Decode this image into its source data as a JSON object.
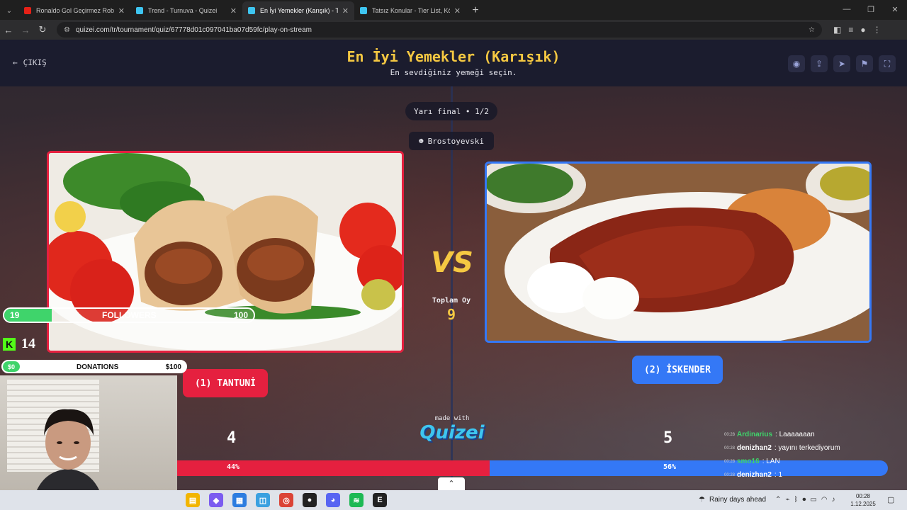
{
  "browser": {
    "tabs": [
      {
        "title": "Ronaldo Gol Geçirmez Robotu",
        "favicon_color": "#e62117",
        "active": false
      },
      {
        "title": "Trend - Turnuva - Quizei",
        "favicon_color": "#3ec5f0",
        "active": false
      },
      {
        "title": "En İyi Yemekler (Karışık) - Tier Li",
        "favicon_color": "#3ec5f0",
        "active": true
      },
      {
        "title": "Tatsız Konular - Tier List, Kör Sı",
        "favicon_color": "#3ec5f0",
        "active": false
      }
    ],
    "url": "quizei.com/tr/tournament/quiz/67778d01c097041ba07d59fc/play-on-stream"
  },
  "header": {
    "exit_label": "ÇIKIŞ",
    "title": "En İyi Yemekler (Karışık)",
    "subtitle": "En sevdiğiniz yemeği seçin."
  },
  "match": {
    "round": "Yarı final • 1/2",
    "streamer": "Brostoyevski",
    "total_label": "Toplam Oy",
    "total_votes": "9",
    "left": {
      "label": "(1) TANTUNİ",
      "votes": "4",
      "percent_label": "44%",
      "percent": 44
    },
    "right": {
      "label": "(2) İSKENDER",
      "votes": "5",
      "percent_label": "56%",
      "percent": 56
    }
  },
  "branding": {
    "made_with": "made with",
    "logo": "Quizei"
  },
  "overlay": {
    "followers": {
      "current": "19",
      "label": "FOLLOWERS",
      "goal": "100",
      "progress": 0.19
    },
    "kick_viewers": "14",
    "donations": {
      "current": "$0",
      "label": "DONATIONS",
      "goal": "$100"
    },
    "chat": [
      {
        "time": "00:28",
        "name": "Ardinarius",
        "name_color": "#3fd46b",
        "text": ": Laaaaaaan"
      },
      {
        "time": "00:28",
        "name": "denizhan2",
        "name_color": "#ffffff",
        "text": ": yayını terkediyorum"
      },
      {
        "time": "00:28",
        "name": "smo16",
        "name_color": "#3fd46b",
        "text": ": LAN"
      },
      {
        "time": "00:28",
        "name": "denizhan2",
        "name_color": "#ffffff",
        "text": ": 1"
      }
    ]
  },
  "taskbar": {
    "weather": "Rainy days ahead",
    "time": "00:28",
    "date": "1.12.2025"
  }
}
